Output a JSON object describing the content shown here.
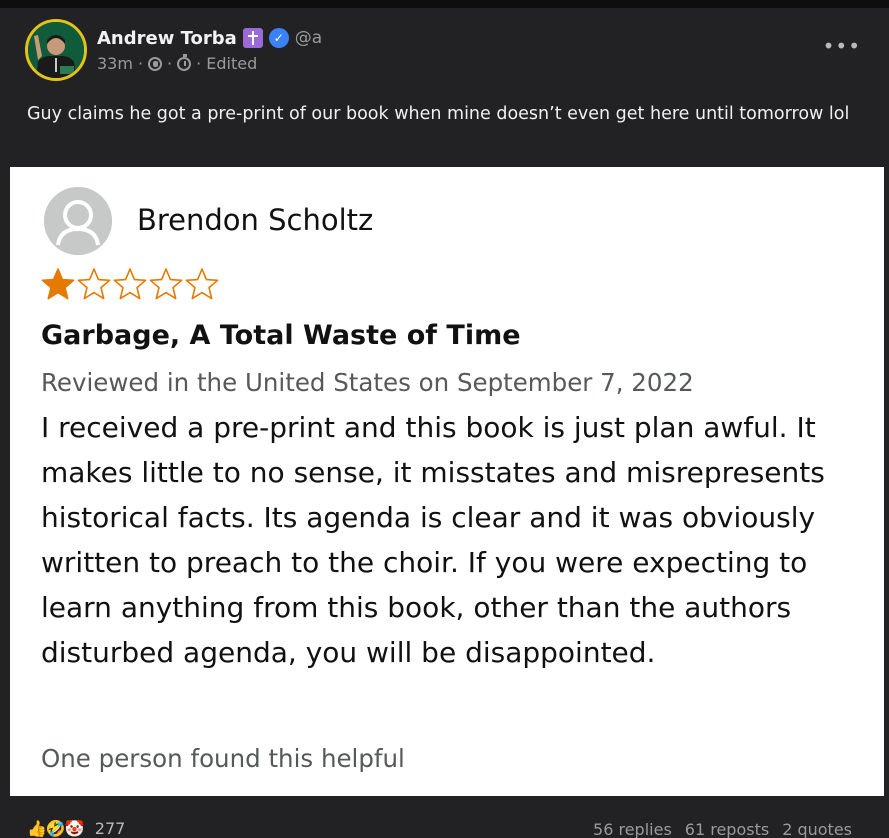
{
  "author": {
    "name": "Andrew Torba",
    "handle": "@a",
    "time": "33m",
    "edited": "Edited",
    "icons": [
      "cross-badge-icon",
      "verified-icon",
      "globe-icon",
      "timer-icon"
    ]
  },
  "post": {
    "text": "Guy claims he got a pre-print of our book when mine doesn’t even get here until tomorrow lol",
    "more_label": "•••"
  },
  "review": {
    "reviewer_name": "Brendon Scholtz",
    "rating": 1,
    "max_rating": 5,
    "title": "Garbage, A Total Waste of Time",
    "date_line": "Reviewed in the United States on September 7, 2022",
    "body": "I received a pre-print and this book is just plan awful. It makes little to no sense, it misstates and misrepresents historical facts. Its agenda is clear and it was obviously written to preach to the choir. If you were expecting to learn anything from this book, other than the authors disturbed agenda, you will be disappointed.",
    "helpful": "One person found this helpful",
    "star_color": "#e67a00"
  },
  "footer": {
    "reactions": [
      "👍",
      "🤣",
      "🤡"
    ],
    "reaction_count": "277",
    "replies": "56 replies",
    "reposts": "61 reposts",
    "quotes": "2 quotes"
  },
  "colors": {
    "background": "#222224",
    "avatar_ring": "#e3c21c",
    "verified": "#3b82f6",
    "cross_badge": "#9b6ad6"
  }
}
